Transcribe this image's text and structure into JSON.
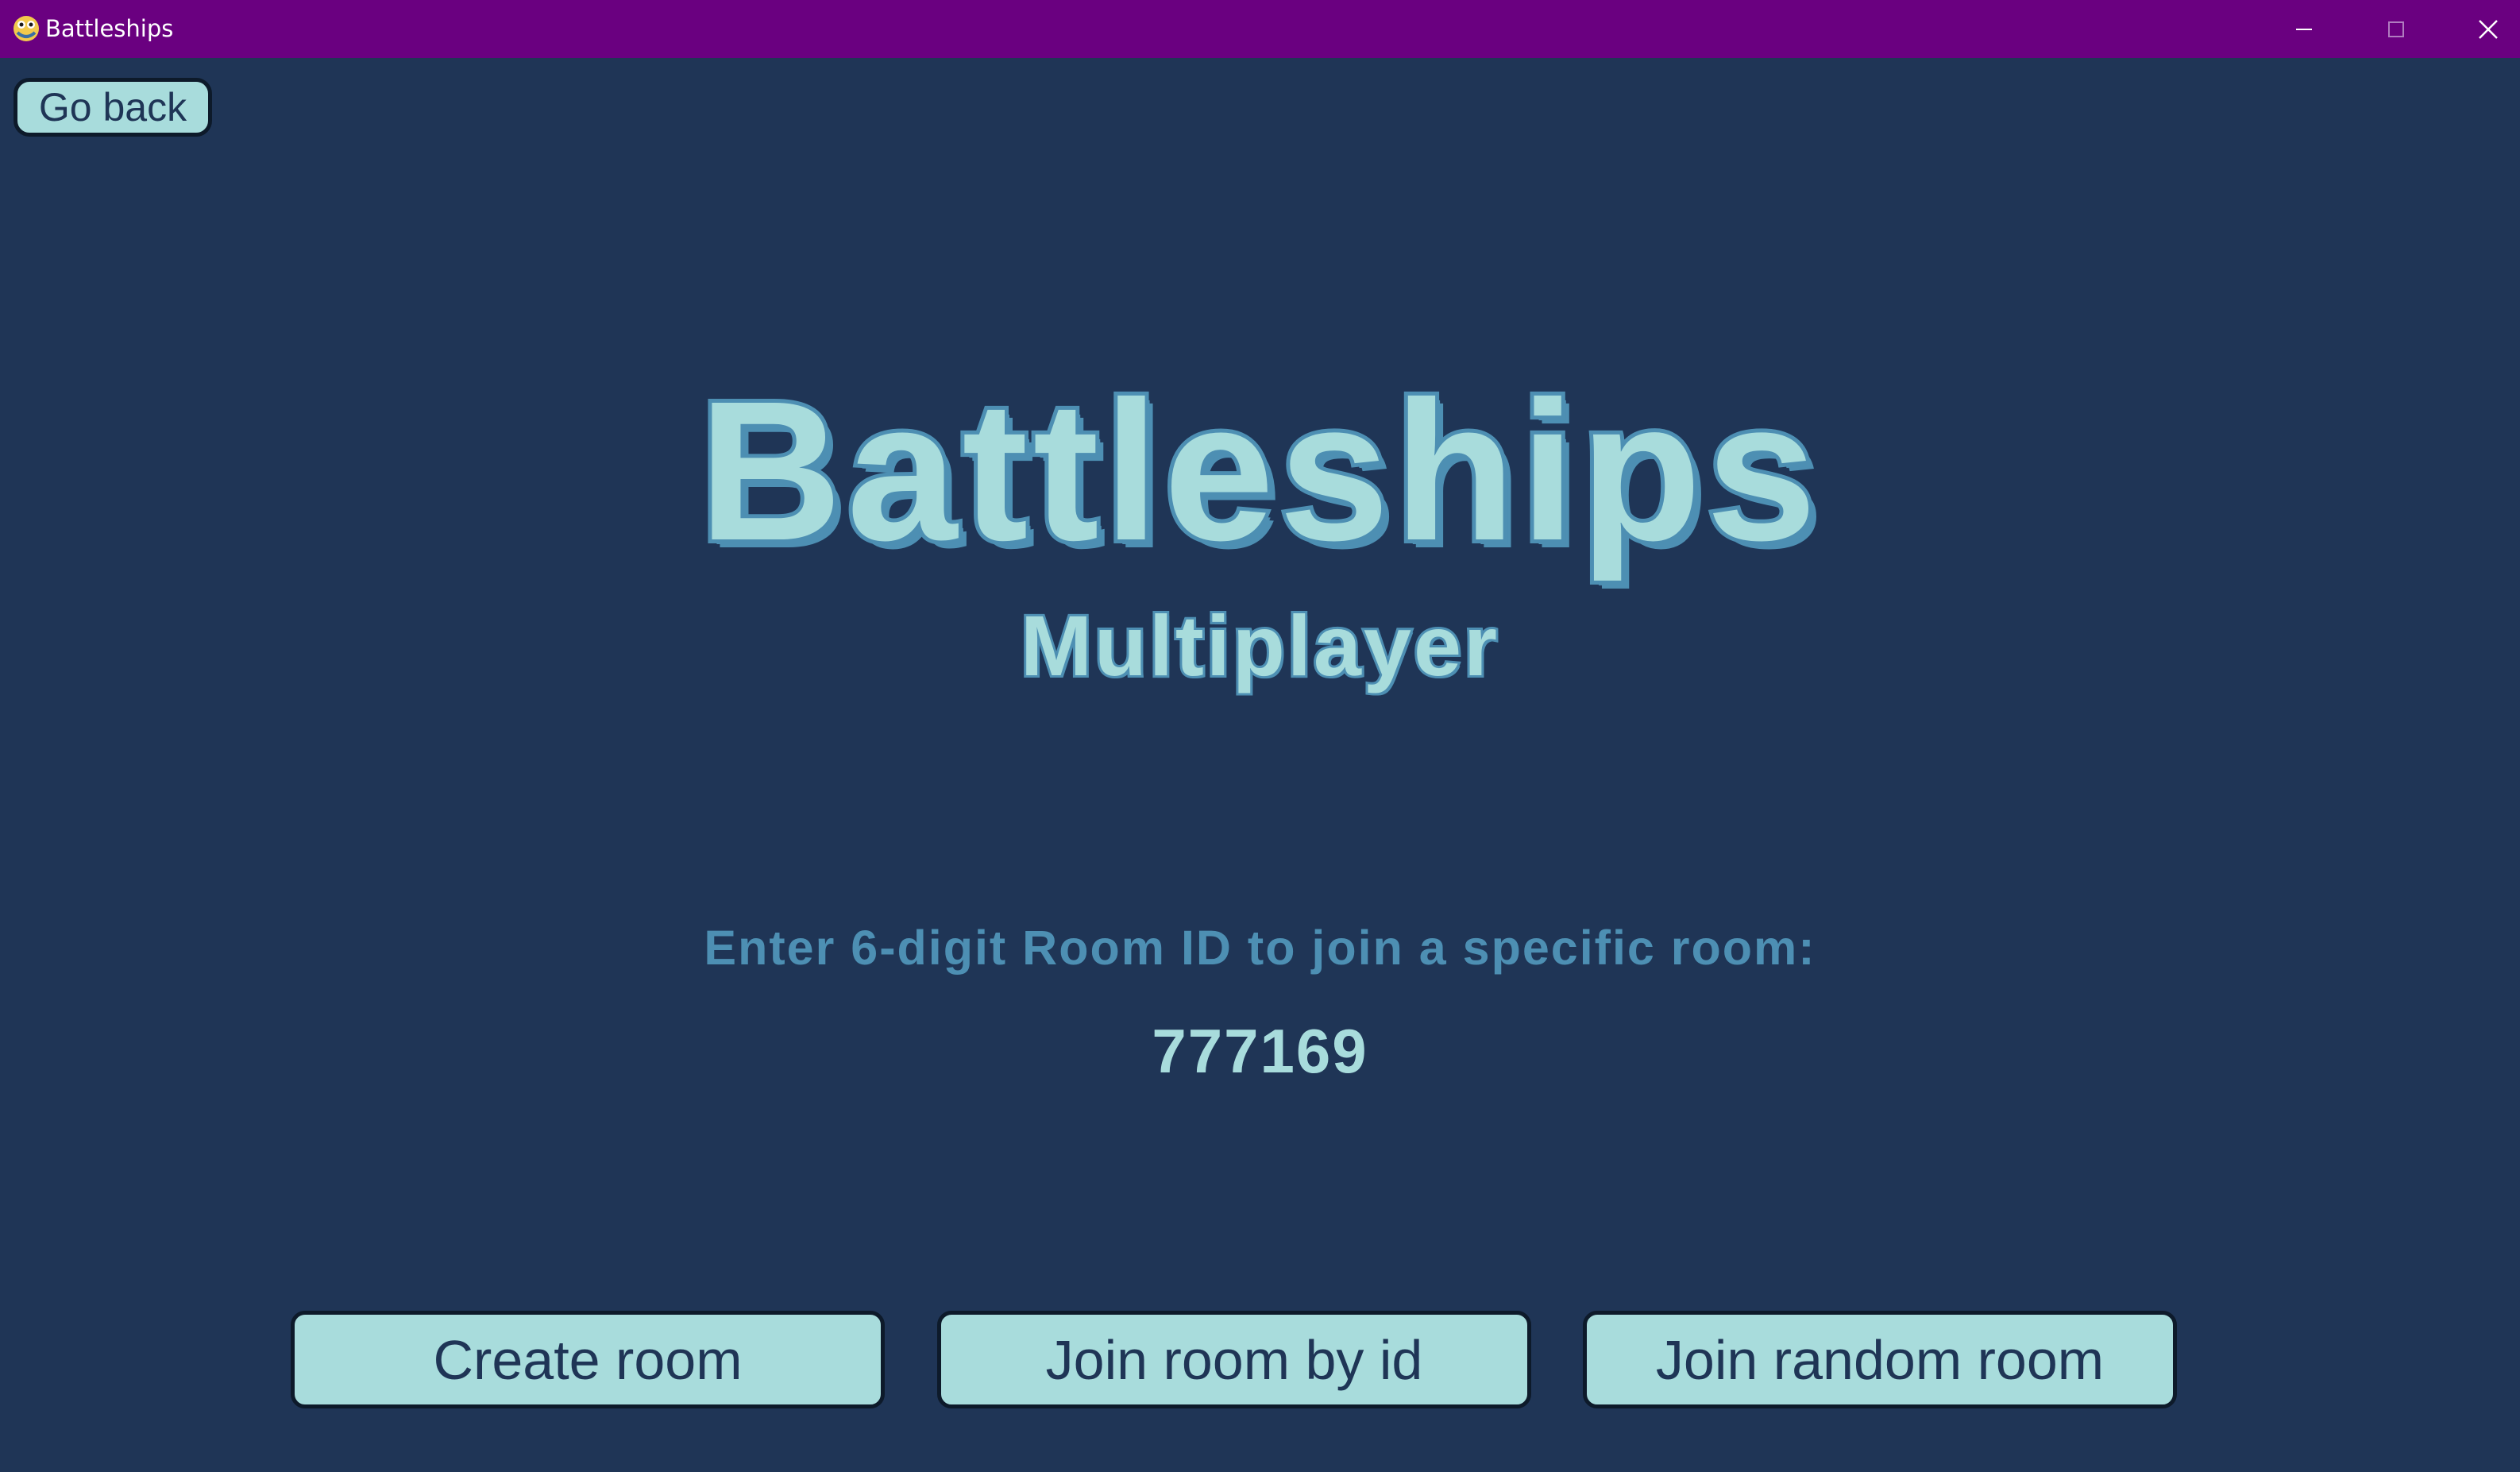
{
  "window": {
    "title": "Battleships",
    "icon": "python-snake-icon",
    "titlebar_color": "#6a0080"
  },
  "nav": {
    "go_back_label": "Go back"
  },
  "header": {
    "title": "Battleships",
    "subtitle": "Multiplayer"
  },
  "room_entry": {
    "prompt": "Enter 6-digit Room ID to join a specific room:",
    "value": "777169"
  },
  "actions": {
    "create_room_label": "Create room",
    "join_by_id_label": "Join room by id",
    "join_random_label": "Join random room"
  },
  "colors": {
    "background": "#1f3556",
    "button_fill": "#a8dcdc",
    "button_border": "#0d1a2a",
    "title_fill": "#a8dcdc",
    "title_outline": "#4d8fb3",
    "prompt_text": "#4d8fb3"
  }
}
